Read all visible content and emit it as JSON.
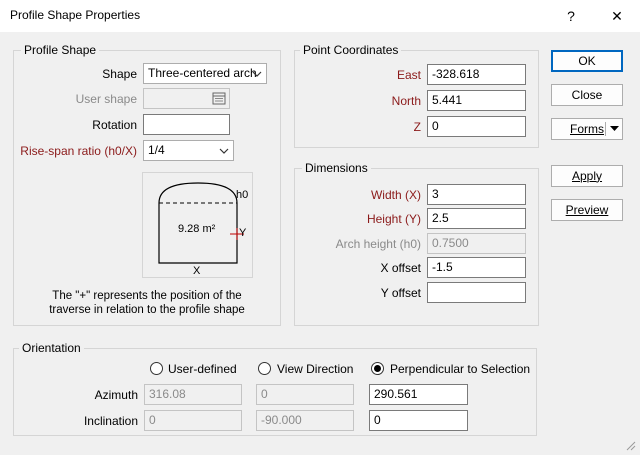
{
  "window": {
    "title": "Profile Shape Properties",
    "help": "?",
    "close": "✕"
  },
  "profile_shape": {
    "group_title": "Profile Shape",
    "shape_label": "Shape",
    "shape_value": "Three-centered arch",
    "user_shape_label": "User shape",
    "rotation_label": "Rotation",
    "rotation_value": "",
    "rise_span_label": "Rise-span ratio (h0/X)",
    "rise_span_value": "1/4",
    "diagram": {
      "area": "9.28 m²",
      "h0": "h0",
      "y": "Y",
      "x": "X"
    },
    "note_line1": "The \"+\" represents the position of the",
    "note_line2": "traverse in relation to the profile shape"
  },
  "point_coordinates": {
    "group_title": "Point Coordinates",
    "east_label": "East",
    "east_value": "-328.618",
    "north_label": "North",
    "north_value": "5.441",
    "z_label": "Z",
    "z_value": "0"
  },
  "dimensions": {
    "group_title": "Dimensions",
    "width_label": "Width (X)",
    "width_value": "3",
    "height_label": "Height (Y)",
    "height_value": "2.5",
    "arch_label": "Arch height (h0)",
    "arch_value": "0.7500",
    "x_offset_label": "X offset",
    "x_offset_value": "-1.5",
    "y_offset_label": "Y offset",
    "y_offset_value": ""
  },
  "buttons": {
    "ok": "OK",
    "close": "Close",
    "forms": "Forms",
    "apply": "Apply",
    "preview": "Preview"
  },
  "orientation": {
    "group_title": "Orientation",
    "options": [
      "User-defined",
      "View Direction",
      "Perpendicular to Selection"
    ],
    "selected": "Perpendicular to Selection",
    "azimuth_label": "Azimuth",
    "azimuth_values": [
      "316.08",
      "0",
      "290.561"
    ],
    "inclination_label": "Inclination",
    "inclination_values": [
      "0",
      "-90.000",
      "0"
    ]
  },
  "colors": {
    "required_label": "#8b1a1a",
    "default_button_border": "#0067c0"
  },
  "icons": [
    "chevron-down-icon",
    "browse-icon",
    "dropdown-arrow-icon",
    "resize-grip-icon"
  ]
}
